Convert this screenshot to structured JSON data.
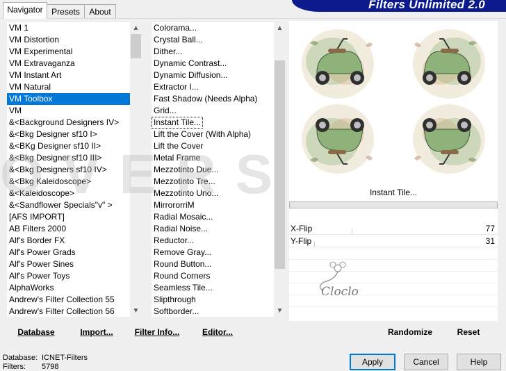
{
  "tabs": [
    {
      "label": "Navigator"
    },
    {
      "label": "Presets"
    },
    {
      "label": "About"
    }
  ],
  "banner": {
    "title": "Filters Unlimited 2.0"
  },
  "watermark": {
    "text": "OVERS"
  },
  "categories": {
    "selected_index": 6,
    "items": [
      "VM 1",
      "VM Distortion",
      "VM Experimental",
      "VM Extravaganza",
      "VM Instant Art",
      "VM Natural",
      "VM Toolbox",
      "VM",
      "&<Background Designers IV>",
      "&<Bkg Designer sf10 I>",
      "&<BKg Designer sf10 II>",
      "&<Bkg Designer sf10 III>",
      "&<Bkg Designers sf10 IV>",
      "&<Bkg Kaleidoscope>",
      "&<Kaleidoscope>",
      "&<Sandflower Specials\"v\" >",
      "[AFS IMPORT]",
      "AB Filters 2000",
      "Alf's Border FX",
      "Alf's Power Grads",
      "Alf's Power Sines",
      "Alf's Power Toys",
      "AlphaWorks",
      "Andrew's Filter Collection 55",
      "Andrew's Filter Collection 56"
    ]
  },
  "filters": {
    "focused_index": 8,
    "items": [
      "Colorama...",
      "Crystal Ball...",
      "Dither...",
      "Dynamic Contrast...",
      "Dynamic Diffusion...",
      "Extractor I...",
      "Fast Shadow (Needs Alpha)",
      "Grid...",
      "Instant Tile...",
      "Lift the Cover (With Alpha)",
      "Lift the Cover",
      "Metal Frame",
      "Mezzotinto Due...",
      "Mezzotinto Tre...",
      "Mezzotinto Uno...",
      "MirrororriM",
      "Radial Mosaic...",
      "Radial Noise...",
      "Reductor...",
      "Remove Gray...",
      "Round Button...",
      "Round Corners",
      "Seamless Tile...",
      "Slipthrough",
      "Softborder..."
    ]
  },
  "scroll": {
    "categories_thumb": 0.07,
    "filters_thumb": 0.7
  },
  "toolbar": {
    "database": "Database",
    "import": "Import...",
    "filter_info": "Filter Info...",
    "editor": "Editor..."
  },
  "filter_panel": {
    "name": "Instant Tile...",
    "params": [
      {
        "label": "X-Flip",
        "value": "77",
        "fraction": 0.3
      },
      {
        "label": "Y-Flip",
        "value": "31",
        "fraction": 0.12
      }
    ],
    "randomize": "Randomize",
    "reset": "Reset"
  },
  "logo": {
    "text": "Cloclo"
  },
  "status": {
    "database_label": "Database:",
    "database_value": "ICNET-Filters",
    "filters_label": "Filters:",
    "filters_value": "5798"
  },
  "dialog": {
    "apply": "Apply",
    "cancel": "Cancel",
    "help": "Help"
  },
  "colors": {
    "selection": "#0078d7",
    "banner": "#0b1a8c",
    "scooter_green": "#8fb27a"
  },
  "icons": {
    "scroll_up": "▲",
    "scroll_down": "▼"
  }
}
